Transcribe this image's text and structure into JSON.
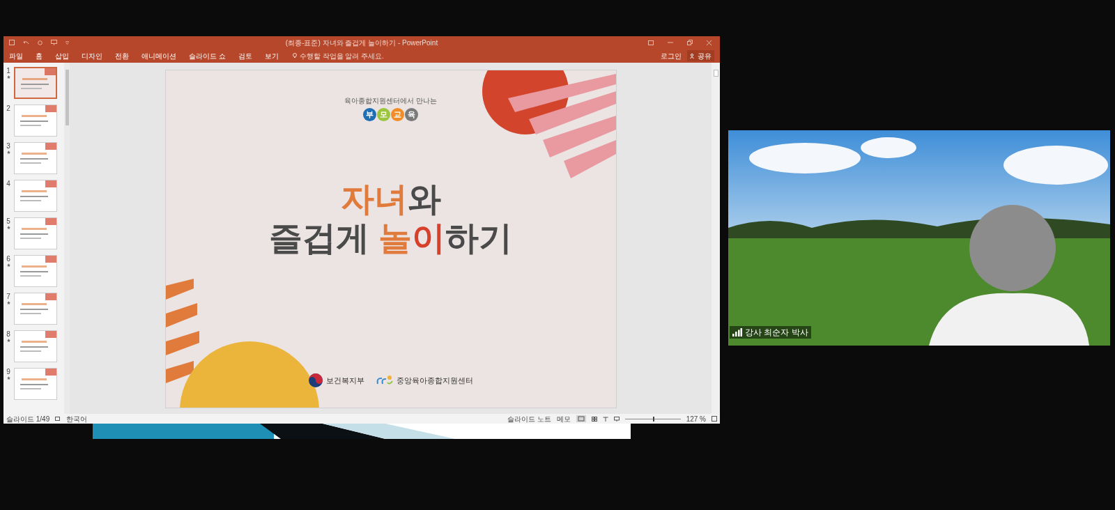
{
  "window": {
    "title": "(최종-표준) 자녀와 즐겁게 놀이하기 - PowerPoint",
    "controls": [
      "로그인",
      "공유"
    ]
  },
  "ribbon_tabs": [
    {
      "label": "파일",
      "selected": false
    },
    {
      "label": "홈",
      "selected": false
    },
    {
      "label": "삽입",
      "selected": false
    },
    {
      "label": "디자인",
      "selected": false
    },
    {
      "label": "전환",
      "selected": false
    },
    {
      "label": "애니메이션",
      "selected": false
    },
    {
      "label": "슬라이드 쇼",
      "selected": false
    },
    {
      "label": "검토",
      "selected": false
    },
    {
      "label": "보기",
      "selected": false
    }
  ],
  "tell_me": {
    "placeholder": "수행할 작업을 알려 주세요."
  },
  "thumbnails": [
    {
      "number": "1",
      "selected": true,
      "animated": true
    },
    {
      "number": "2",
      "selected": false,
      "animated": false
    },
    {
      "number": "3",
      "selected": false,
      "animated": true
    },
    {
      "number": "4",
      "selected": false,
      "animated": false
    },
    {
      "number": "5",
      "selected": false,
      "animated": true
    },
    {
      "number": "6",
      "selected": false,
      "animated": true
    },
    {
      "number": "7",
      "selected": false,
      "animated": true
    },
    {
      "number": "8",
      "selected": false,
      "animated": true
    },
    {
      "number": "9",
      "selected": false,
      "animated": true
    }
  ],
  "slide": {
    "subtitle": "육아종합지원센터에서 만나는",
    "badges": [
      {
        "text": "부",
        "color": "#1f6eb4"
      },
      {
        "text": "모",
        "color": "#9bc53d"
      },
      {
        "text": "교",
        "color": "#f28c28"
      },
      {
        "text": "육",
        "color": "#7a7a7a"
      }
    ],
    "title_lines": [
      [
        {
          "text": "자녀",
          "color": "#e07b3c"
        },
        {
          "text": "와",
          "color": "#4a4a4a"
        }
      ],
      [
        {
          "text": "즐겁게 ",
          "color": "#4a4a4a"
        },
        {
          "text": "놀",
          "color": "#e07b3c"
        },
        {
          "text": "이",
          "color": "#d7402a"
        },
        {
          "text": "하기",
          "color": "#4a4a4a"
        }
      ]
    ],
    "logos": [
      "보건복지부",
      "중앙육아종합지원센터"
    ]
  },
  "status_bar": {
    "slide": "슬라이드 1/49",
    "language": "한국어",
    "notes": "슬라이드 노트",
    "comments": "메모",
    "zoom": "127 %",
    "zoom_slider": {
      "level": 0.5
    }
  },
  "video": {
    "name": "강사 최순자 박사"
  }
}
